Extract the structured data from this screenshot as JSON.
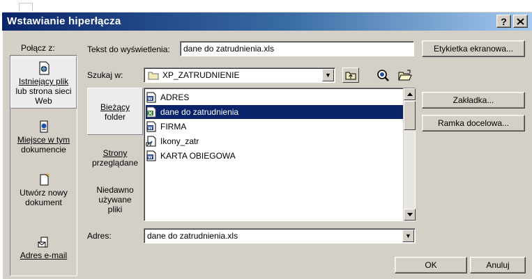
{
  "window": {
    "title": "Wstawianie hiperłącza",
    "help_button": "?",
    "close_button": "✕"
  },
  "link_to": {
    "label": "Połącz z:",
    "items": [
      {
        "label_line1": "Istniejący plik",
        "label_line2": "lub strona sieci",
        "label_line3": "Web",
        "icon": "existing-file-icon"
      },
      {
        "label_line1": "Miejsce w tym",
        "label_line2": "dokumencie",
        "icon": "place-in-document-icon"
      },
      {
        "label_line1": "Utwórz nowy",
        "label_line2": "dokument",
        "icon": "new-document-icon"
      },
      {
        "label_line1": "Adres e-mail",
        "icon": "email-address-icon"
      }
    ]
  },
  "display_text": {
    "label": "Tekst do wyświetlenia:",
    "value": "dane do zatrudnienia.xls"
  },
  "screen_tip_button": "Etykietka ekranowa...",
  "look_in": {
    "label": "Szukaj w:",
    "value": "XP_ZATRUDNIENIE"
  },
  "browse_sections": [
    {
      "line1": "Bieżący",
      "line2": "folder"
    },
    {
      "line1": "Strony",
      "line2": "przeglądane"
    },
    {
      "line1": "Niedawno",
      "line2": "używane",
      "line3": "pliki"
    }
  ],
  "files": [
    {
      "name": "ADRES",
      "icon": "word-document-icon",
      "selected": false
    },
    {
      "name": "dane do zatrudnienia",
      "icon": "excel-document-icon",
      "selected": true
    },
    {
      "name": "FIRMA",
      "icon": "word-document-icon",
      "selected": false
    },
    {
      "name": "Ikony_zatr",
      "icon": "shortcut-icon",
      "selected": false
    },
    {
      "name": "KARTA OBIEGOWA",
      "icon": "word-document-icon",
      "selected": false
    }
  ],
  "bookmark_button": "Zakładka...",
  "target_frame_button": "Ramka docelowa...",
  "address": {
    "label": "Adres:",
    "value": "dane do zatrudnienia.xls"
  },
  "ok_button": "OK",
  "cancel_button": "Anuluj",
  "colors": {
    "title_gradient_start": "#0a246a",
    "title_gradient_end": "#a6caf0",
    "dialog_face": "#d4d0c8",
    "selection": "#0a246a"
  }
}
